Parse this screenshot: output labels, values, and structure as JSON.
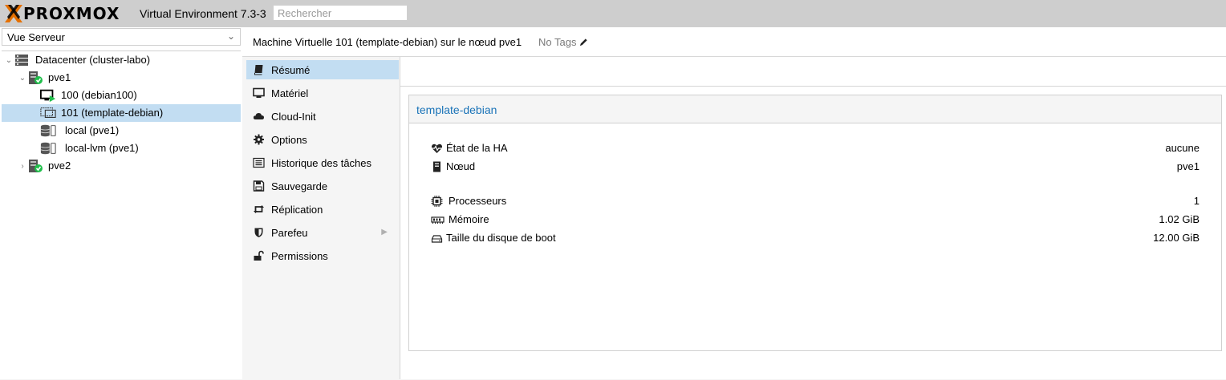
{
  "header": {
    "logo_text": "PROXMOX",
    "product": "Virtual Environment 7.3-3",
    "search_placeholder": "Rechercher"
  },
  "sidebar": {
    "view_selector": "Vue Serveur",
    "tree": [
      {
        "label": "Datacenter (cluster-labo)",
        "icon": "datacenter-icon"
      },
      {
        "label": "pve1",
        "icon": "node-online-icon"
      },
      {
        "label": "100 (debian100)",
        "icon": "vm-running-icon"
      },
      {
        "label": "101 (template-debian)",
        "icon": "template-icon",
        "selected": true
      },
      {
        "label": "local (pve1)",
        "icon": "storage-icon"
      },
      {
        "label": "local-lvm (pve1)",
        "icon": "storage-icon"
      },
      {
        "label": "pve2",
        "icon": "node-online-icon"
      }
    ]
  },
  "main": {
    "title": "Machine Virtuelle 101 (template-debian) sur le nœud pve1",
    "tags": "No Tags",
    "nav": [
      {
        "label": "Résumé",
        "icon": "book-icon",
        "selected": true
      },
      {
        "label": "Matériel",
        "icon": "monitor-icon"
      },
      {
        "label": "Cloud-Init",
        "icon": "cloud-icon"
      },
      {
        "label": "Options",
        "icon": "gear-icon"
      },
      {
        "label": "Historique des tâches",
        "icon": "list-icon"
      },
      {
        "label": "Sauvegarde",
        "icon": "floppy-icon"
      },
      {
        "label": "Réplication",
        "icon": "retweet-icon"
      },
      {
        "label": "Parefeu",
        "icon": "shield-icon"
      },
      {
        "label": "Permissions",
        "icon": "unlock-icon"
      }
    ],
    "summary": {
      "panel_title": "template-debian",
      "rows": [
        {
          "label": "État de la HA",
          "value": "aucune",
          "icon": "heartbeat-icon"
        },
        {
          "label": "Nœud",
          "value": "pve1",
          "icon": "server-icon"
        },
        {
          "label": "Processeurs",
          "value": "1",
          "icon": "cpu-icon"
        },
        {
          "label": "Mémoire",
          "value": "1.02 GiB",
          "icon": "memory-icon"
        },
        {
          "label": "Taille du disque de boot",
          "value": "12.00 GiB",
          "icon": "hdd-icon"
        }
      ]
    }
  },
  "colors": {
    "accent": "#1a73b8",
    "selection": "#c2ddf2",
    "logo_orange": "#e57000",
    "status_green": "#21bf4b"
  }
}
